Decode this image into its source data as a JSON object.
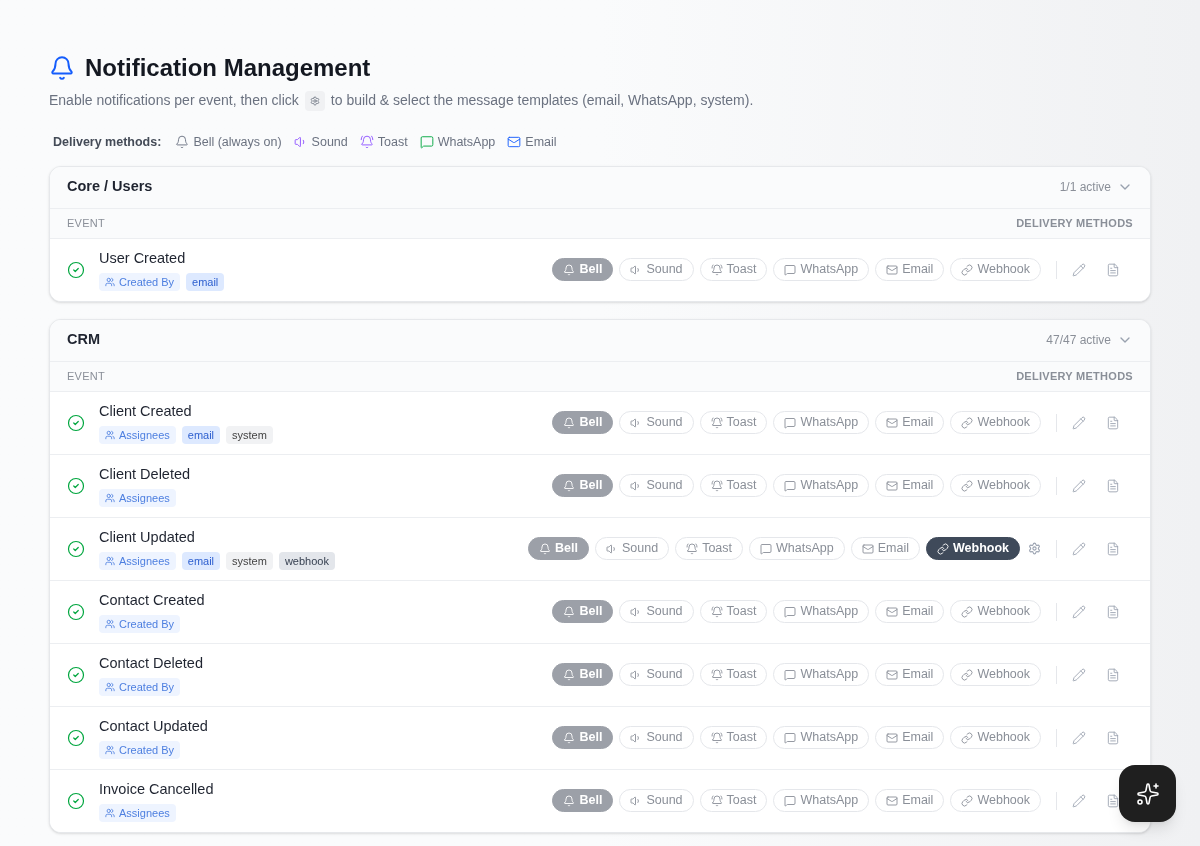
{
  "header": {
    "title": "Notification Management",
    "subtitle_before": "Enable notifications per event, then click",
    "subtitle_after": "to build & select the message templates (email, WhatsApp, system)."
  },
  "legend": {
    "label": "Delivery methods:",
    "items": [
      {
        "label": "Bell (always on)",
        "kind": "bell"
      },
      {
        "label": "Sound",
        "kind": "sound"
      },
      {
        "label": "Toast",
        "kind": "toast"
      },
      {
        "label": "WhatsApp",
        "kind": "whatsapp"
      },
      {
        "label": "Email",
        "kind": "email"
      }
    ]
  },
  "sections": [
    {
      "title": "Core / Users",
      "count": "1/1 active",
      "expanded": true,
      "columns": [
        "EVENT",
        "DELIVERY METHODS"
      ],
      "rows": [
        {
          "name": "User Created",
          "enabled": true,
          "tags": [
            {
              "label": "Created By",
              "kind": "audience"
            },
            {
              "label": "email",
              "kind": "email"
            }
          ],
          "methods": [
            {
              "label": "Bell",
              "kind": "bell",
              "on": true
            },
            {
              "label": "Sound",
              "kind": "sound",
              "on": false
            },
            {
              "label": "Toast",
              "kind": "toast",
              "on": false
            },
            {
              "label": "WhatsApp",
              "kind": "whatsapp",
              "on": false
            },
            {
              "label": "Email",
              "kind": "email",
              "on": false
            },
            {
              "label": "Webhook",
              "kind": "webhook",
              "on": false
            }
          ]
        }
      ]
    },
    {
      "title": "CRM",
      "count": "47/47 active",
      "expanded": true,
      "columns": [
        "EVENT",
        "DELIVERY METHODS"
      ],
      "rows": [
        {
          "name": "Client Created",
          "enabled": true,
          "tags": [
            {
              "label": "Assignees",
              "kind": "audience"
            },
            {
              "label": "email",
              "kind": "email"
            },
            {
              "label": "system",
              "kind": "system"
            }
          ],
          "methods": [
            {
              "label": "Bell",
              "kind": "bell",
              "on": true
            },
            {
              "label": "Sound",
              "kind": "sound",
              "on": false
            },
            {
              "label": "Toast",
              "kind": "toast",
              "on": false
            },
            {
              "label": "WhatsApp",
              "kind": "whatsapp",
              "on": false
            },
            {
              "label": "Email",
              "kind": "email",
              "on": false
            },
            {
              "label": "Webhook",
              "kind": "webhook",
              "on": false
            }
          ]
        },
        {
          "name": "Client Deleted",
          "enabled": true,
          "tags": [
            {
              "label": "Assignees",
              "kind": "audience"
            }
          ],
          "methods": [
            {
              "label": "Bell",
              "kind": "bell",
              "on": true
            },
            {
              "label": "Sound",
              "kind": "sound",
              "on": false
            },
            {
              "label": "Toast",
              "kind": "toast",
              "on": false
            },
            {
              "label": "WhatsApp",
              "kind": "whatsapp",
              "on": false
            },
            {
              "label": "Email",
              "kind": "email",
              "on": false
            },
            {
              "label": "Webhook",
              "kind": "webhook",
              "on": false
            }
          ]
        },
        {
          "name": "Client Updated",
          "enabled": true,
          "tags": [
            {
              "label": "Assignees",
              "kind": "audience"
            },
            {
              "label": "email",
              "kind": "email"
            },
            {
              "label": "system",
              "kind": "system"
            },
            {
              "label": "webhook",
              "kind": "webhook"
            }
          ],
          "methods": [
            {
              "label": "Bell",
              "kind": "bell",
              "on": true
            },
            {
              "label": "Sound",
              "kind": "sound",
              "on": false
            },
            {
              "label": "Toast",
              "kind": "toast",
              "on": false
            },
            {
              "label": "WhatsApp",
              "kind": "whatsapp",
              "on": false
            },
            {
              "label": "Email",
              "kind": "email",
              "on": false
            },
            {
              "label": "Webhook",
              "kind": "webhook",
              "on": true
            }
          ]
        },
        {
          "name": "Contact Created",
          "enabled": true,
          "tags": [
            {
              "label": "Created By",
              "kind": "audience"
            }
          ],
          "methods": [
            {
              "label": "Bell",
              "kind": "bell",
              "on": true
            },
            {
              "label": "Sound",
              "kind": "sound",
              "on": false
            },
            {
              "label": "Toast",
              "kind": "toast",
              "on": false
            },
            {
              "label": "WhatsApp",
              "kind": "whatsapp",
              "on": false
            },
            {
              "label": "Email",
              "kind": "email",
              "on": false
            },
            {
              "label": "Webhook",
              "kind": "webhook",
              "on": false
            }
          ]
        },
        {
          "name": "Contact Deleted",
          "enabled": true,
          "tags": [
            {
              "label": "Created By",
              "kind": "audience"
            }
          ],
          "methods": [
            {
              "label": "Bell",
              "kind": "bell",
              "on": true
            },
            {
              "label": "Sound",
              "kind": "sound",
              "on": false
            },
            {
              "label": "Toast",
              "kind": "toast",
              "on": false
            },
            {
              "label": "WhatsApp",
              "kind": "whatsapp",
              "on": false
            },
            {
              "label": "Email",
              "kind": "email",
              "on": false
            },
            {
              "label": "Webhook",
              "kind": "webhook",
              "on": false
            }
          ]
        },
        {
          "name": "Contact Updated",
          "enabled": true,
          "tags": [
            {
              "label": "Created By",
              "kind": "audience"
            }
          ],
          "methods": [
            {
              "label": "Bell",
              "kind": "bell",
              "on": true
            },
            {
              "label": "Sound",
              "kind": "sound",
              "on": false
            },
            {
              "label": "Toast",
              "kind": "toast",
              "on": false
            },
            {
              "label": "WhatsApp",
              "kind": "whatsapp",
              "on": false
            },
            {
              "label": "Email",
              "kind": "email",
              "on": false
            },
            {
              "label": "Webhook",
              "kind": "webhook",
              "on": false
            }
          ]
        },
        {
          "name": "Invoice Cancelled",
          "enabled": true,
          "tags": [
            {
              "label": "Assignees",
              "kind": "audience"
            }
          ],
          "methods": [
            {
              "label": "Bell",
              "kind": "bell",
              "on": true
            },
            {
              "label": "Sound",
              "kind": "sound",
              "on": false
            },
            {
              "label": "Toast",
              "kind": "toast",
              "on": false
            },
            {
              "label": "WhatsApp",
              "kind": "whatsapp",
              "on": false
            },
            {
              "label": "Email",
              "kind": "email",
              "on": false
            },
            {
              "label": "Webhook",
              "kind": "webhook",
              "on": false
            }
          ]
        }
      ]
    }
  ]
}
